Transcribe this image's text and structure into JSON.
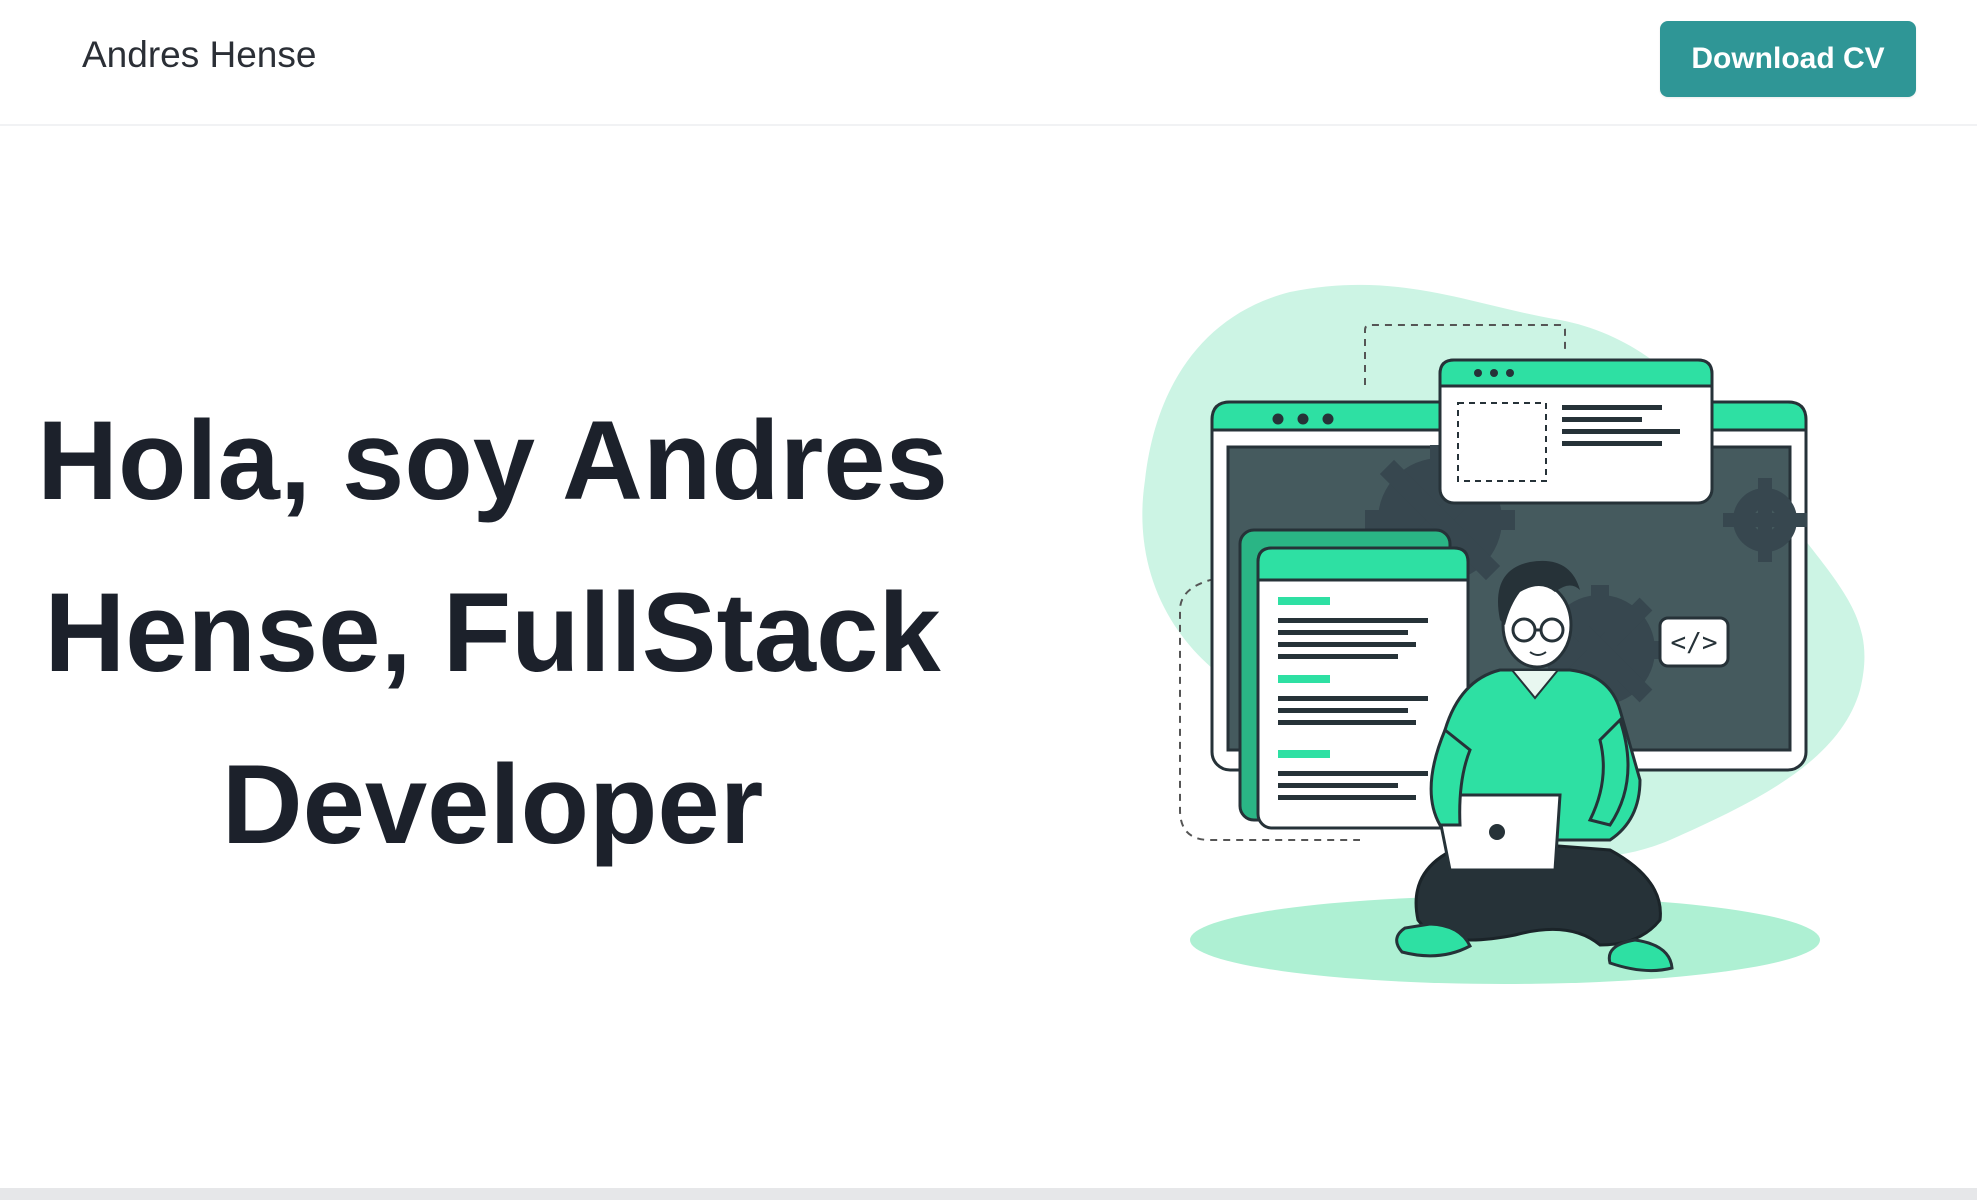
{
  "navbar": {
    "brand": "Andres Hense",
    "download_cv_label": "Download CV"
  },
  "hero": {
    "title": "Hola, soy Andres Hense, FullStack Developer",
    "illustration": {
      "icon": "developer-at-laptop-illustration",
      "code_badge": "</>"
    }
  },
  "colors": {
    "accent": "#2f9696",
    "illustration_green": "#2ee0a3",
    "illustration_blob": "#ccf4e4",
    "heading_text": "#1c212b",
    "dark": "#263238"
  }
}
